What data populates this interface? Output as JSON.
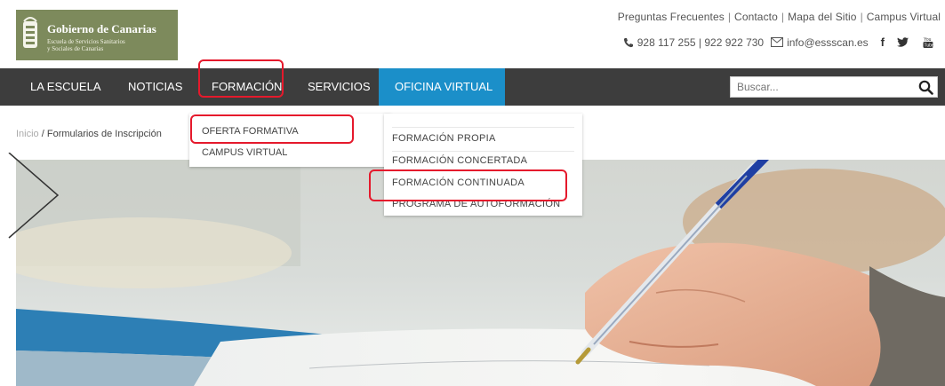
{
  "header": {
    "logo": {
      "title": "Gobierno de Canarias",
      "subtitle_line1": "Escuela de Servicios Sanitarios",
      "subtitle_line2": "y Sociales de Canarias"
    },
    "top_links": [
      "Preguntas Frecuentes",
      "Contacto",
      "Mapa del Sitio",
      "Campus Virtual"
    ],
    "phone": "928 117 255 | 922 922 730",
    "email": "info@essscan.es",
    "social": [
      "facebook-icon",
      "twitter-icon",
      "youtube-icon"
    ]
  },
  "nav": {
    "items": [
      "LA ESCUELA",
      "NOTICIAS",
      "FORMACIÓN",
      "SERVICIOS",
      "OFICINA VIRTUAL"
    ],
    "active": "OFICINA VIRTUAL",
    "active_color": "#1b8fc9",
    "search_placeholder": "Buscar..."
  },
  "breadcrumb": {
    "home": "Inicio",
    "separator": " / ",
    "current": "Formularios de Inscripción"
  },
  "dropdown_formacion": [
    "OFERTA FORMATIVA",
    "CAMPUS VIRTUAL"
  ],
  "dropdown_oferta": [
    "FORMACIÓN PROPIA",
    "FORMACIÓN CONCERTADA",
    "FORMACIÓN CONTINUADA",
    "PROGRAMA DE AUTOFORMACIÓN"
  ],
  "highlight_color": "#e5192c",
  "hero": {
    "icon": "writing-hand-image"
  }
}
